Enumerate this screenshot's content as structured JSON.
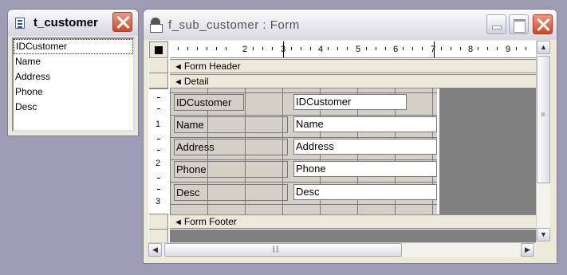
{
  "field_list": {
    "title": "t_customer",
    "fields": [
      "IDCustomer",
      "Name",
      "Address",
      "Phone",
      "Desc"
    ]
  },
  "form_window": {
    "title": "f_sub_customer : Form",
    "ruler": {
      "h_numbers": [
        "1",
        "2",
        "3",
        "4",
        "5",
        "6",
        "7",
        "8",
        "9"
      ],
      "v_numbers": [
        "1",
        "2",
        "3"
      ]
    },
    "sections": {
      "header": "Form Header",
      "detail": "Detail",
      "footer": "Form Footer"
    },
    "controls": [
      {
        "label": "IDCustomer",
        "textbox": "IDCustomer"
      },
      {
        "label": "Name",
        "textbox": "Name"
      },
      {
        "label": "Address",
        "textbox": "Address"
      },
      {
        "label": "Phone",
        "textbox": "Phone"
      },
      {
        "label": "Desc",
        "textbox": "Desc"
      }
    ]
  },
  "icons": [
    "table-icon",
    "form-icon",
    "close-icon",
    "minimize-icon",
    "maximize-icon",
    "scroll-up-icon",
    "scroll-down-icon",
    "scroll-left-icon",
    "scroll-right-icon"
  ],
  "colors": {
    "desktop": "#9d9cb4",
    "grid": "#d4d0c8",
    "close": "#d2472b"
  }
}
